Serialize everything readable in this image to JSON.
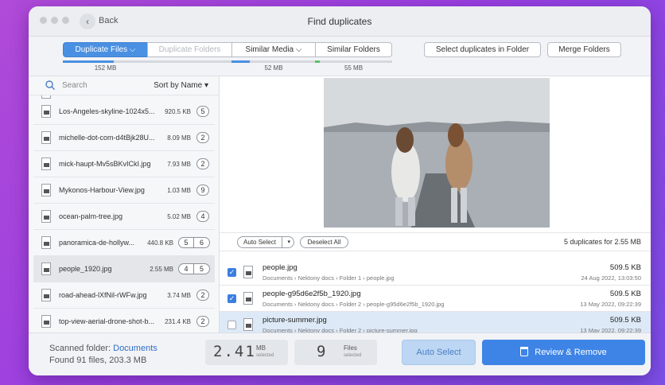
{
  "window": {
    "title": "Find duplicates",
    "back_label": "Back"
  },
  "tabs": [
    {
      "label": "Duplicate Files ⌵",
      "size": "152 MB"
    },
    {
      "label": "Duplicate Folders",
      "size": ""
    },
    {
      "label": "Similar Media ⌵",
      "size": "52 MB"
    },
    {
      "label": "Similar Folders",
      "size": "55 MB"
    }
  ],
  "tab_progress": [
    0.6,
    0.0,
    0.22,
    0.06
  ],
  "toolbar": {
    "select_in_folder": "Select duplicates in Folder",
    "merge_folders": "Merge Folders"
  },
  "sidebar": {
    "search_placeholder": "Search",
    "sort_label": "Sort by Name ▾",
    "files": [
      {
        "name": "Los-Angeles-skyline-1024x5...",
        "size": "920.5 KB",
        "count": "5"
      },
      {
        "name": "michelle-dot-com-d4tBjk28U...",
        "size": "8.09 MB",
        "count": "2"
      },
      {
        "name": "mick-haupt-Mv5sBKvICkI.jpg",
        "size": "7.93 MB",
        "count": "2"
      },
      {
        "name": "Mykonos-Harbour-View.jpg",
        "size": "1.03 MB",
        "count": "9"
      },
      {
        "name": "ocean-palm-tree.jpg",
        "size": "5.02 MB",
        "count": "4"
      },
      {
        "name": "panoramica-de-hollyw...",
        "size": "440.8 KB",
        "count": "5",
        "count2": "6"
      },
      {
        "name": "people_1920.jpg",
        "size": "2.55 MB",
        "count": "4",
        "count2": "5"
      },
      {
        "name": "road-ahead-lXfNil-rWFw.jpg",
        "size": "3.74 MB",
        "count": "2"
      },
      {
        "name": "top-view-aerial-drone-shot-b...",
        "size": "231.4 KB",
        "count": "2"
      }
    ]
  },
  "controls": {
    "auto_select": "Auto Select",
    "deselect_all": "Deselect All",
    "dup_summary": "5 duplicates for 2.55 MB"
  },
  "duplicates": [
    {
      "name": "people.jpg",
      "path": "Documents › Nektony docs › Folder 1 › people.jpg",
      "size": "509.5 KB",
      "date": "24 Aug 2022, 13:03:50",
      "checked": true
    },
    {
      "name": "people-g95d6e2f5b_1920.jpg",
      "path": "Documents › Nektony docs › Folder 2 › people-g95d6e2f5b_1920.jpg",
      "size": "509.5 KB",
      "date": "13 May 2022, 09:22:39",
      "checked": true
    },
    {
      "name": "picture-summer.jpg",
      "path": "Documents › Nektony docs › Folder 2 › picture-summer.jpg",
      "size": "509.5 KB",
      "date": "13 May 2022, 09:22:39",
      "checked": false
    }
  ],
  "footer": {
    "scanned_prefix": "Scanned folder:",
    "scanned_folder": "Documents",
    "found_text": "Found 91 files, 203.3 MB",
    "size_value": "2.41",
    "size_unit": "MB",
    "size_sub": "selected",
    "files_value": "9",
    "files_unit": "Files",
    "files_sub": "selected",
    "auto_select_label": "Auto Select",
    "review_label": "Review & Remove"
  },
  "colors": {
    "accent": "#3e84e6",
    "tab_active": "#4a90e2",
    "bar_green": "#5cc26a",
    "bar_blue": "#4a90e2"
  }
}
